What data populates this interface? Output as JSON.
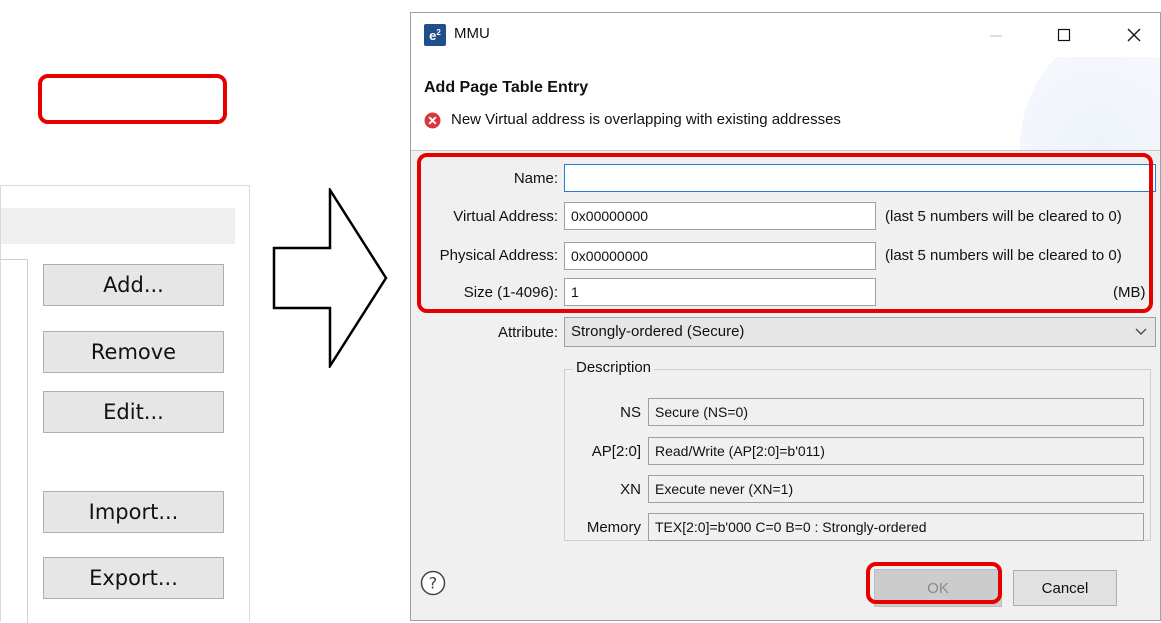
{
  "left_panel": {
    "buttons": {
      "add": "Add...",
      "remove": "Remove",
      "edit": "Edit...",
      "import": "Import...",
      "export": "Export..."
    }
  },
  "dialog": {
    "app_logo": "e",
    "app_logo_sup": "2",
    "window_title": "MMU",
    "heading": "Add Page Table Entry",
    "error_message": "New Virtual address is overlapping with existing addresses",
    "fields": {
      "name_label": "Name:",
      "name_value": "",
      "virtual_address_label": "Virtual Address:",
      "virtual_address_value": "0x00000000",
      "virtual_address_note": "(last 5 numbers will be cleared to 0)",
      "physical_address_label": "Physical Address:",
      "physical_address_value": "0x00000000",
      "physical_address_note": "(last 5 numbers will be cleared to 0)",
      "size_label": "Size (1-4096):",
      "size_value": "1",
      "size_unit": "(MB)",
      "attribute_label": "Attribute:",
      "attribute_value": "Strongly-ordered (Secure)"
    },
    "description": {
      "legend": "Description",
      "rows": [
        {
          "label": "NS",
          "value": "Secure (NS=0)"
        },
        {
          "label": "AP[2:0]",
          "value": "Read/Write (AP[2:0]=b'011)"
        },
        {
          "label": "XN",
          "value": "Execute never (XN=1)"
        },
        {
          "label": "Memory",
          "value": "TEX[2:0]=b'000 C=0 B=0 : Strongly-ordered"
        }
      ]
    },
    "buttons": {
      "ok": "OK",
      "cancel": "Cancel"
    }
  },
  "colors": {
    "highlight": "#e60000",
    "error_icon": "#d9363e",
    "app_logo_bg": "#1e4e8c",
    "focus_border": "#2b79d8"
  },
  "icons": [
    "arrow-right-icon",
    "error-icon",
    "help-icon",
    "chevron-down-icon",
    "minimize-icon",
    "maximize-icon",
    "close-icon"
  ]
}
